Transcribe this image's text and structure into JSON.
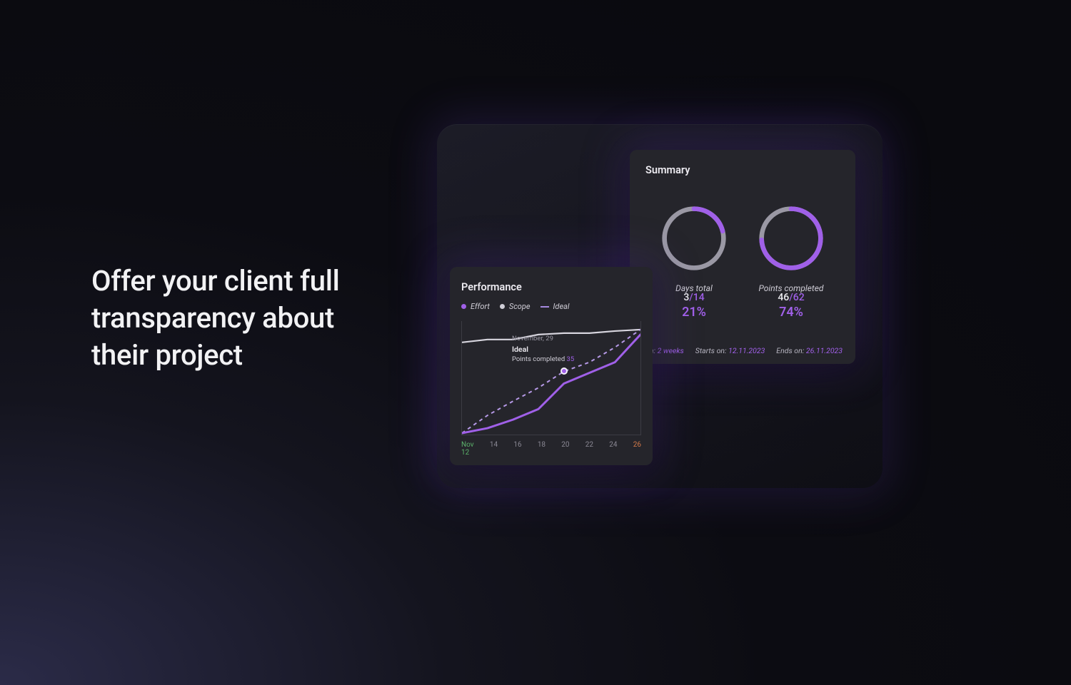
{
  "headline": "Offer your client full transparency about their project",
  "colors": {
    "accent": "#a060e8",
    "grey": "#cfcdd6",
    "track": "#9a98a4",
    "success": "#5bb06a",
    "warning": "#d47a4a"
  },
  "summary": {
    "title": "Summary",
    "gauges": [
      {
        "numerator": "3",
        "denominator": "14",
        "percent": "21%",
        "label": "Days total",
        "frac": 0.21
      },
      {
        "numerator": "46",
        "denominator": "62",
        "percent": "74%",
        "label": "Points completed",
        "frac": 0.74
      }
    ],
    "footer": {
      "duration_label": "t duration:",
      "duration_value": "2 weeks",
      "starts_label": "Starts on:",
      "starts_value": "12.11.2023",
      "ends_label": "Ends on:",
      "ends_value": "26.11.2023"
    }
  },
  "performance": {
    "title": "Performance",
    "legend": {
      "effort": "Effort",
      "scope": "Scope",
      "ideal": "Ideal"
    },
    "tooltip": {
      "date": "November, 29",
      "series": "Ideal",
      "metric_label": "Points completed",
      "metric_value": "35"
    },
    "x_ticks": [
      "Nov\n12",
      "14",
      "16",
      "18",
      "20",
      "22",
      "24",
      "26"
    ]
  },
  "chart_data": {
    "type": "line",
    "title": "Performance",
    "xlabel": "",
    "ylabel": "",
    "ylim": [
      0,
      62
    ],
    "categories": [
      "Nov 12",
      "14",
      "16",
      "18",
      "20",
      "22",
      "24",
      "26"
    ],
    "series": [
      {
        "name": "Scope",
        "values": [
          50,
          52,
          52,
          55,
          56,
          56,
          57,
          58
        ]
      },
      {
        "name": "Ideal",
        "values": [
          0,
          10,
          18,
          26,
          35,
          40,
          48,
          58
        ]
      },
      {
        "name": "Effort",
        "values": [
          0,
          3,
          8,
          14,
          28,
          34,
          40,
          55
        ]
      }
    ],
    "marker": {
      "series": "Ideal",
      "x": "20",
      "value": 35
    }
  }
}
